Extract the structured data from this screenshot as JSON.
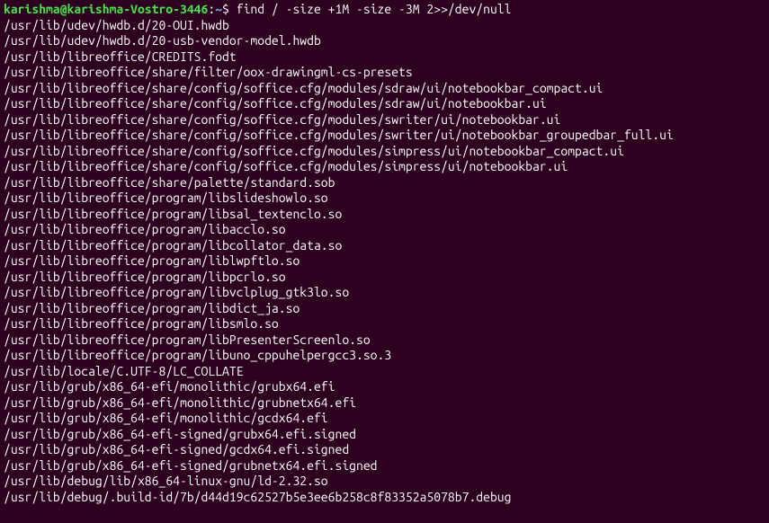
{
  "terminal": {
    "prompt": {
      "user_host": "karishma@karishma-Vostro-3446",
      "colon": ":",
      "path": "~",
      "dollar": "$"
    },
    "command": " find / -size +1M -size -3M 2>>/dev/null",
    "output": [
      "/usr/lib/udev/hwdb.d/20-OUI.hwdb",
      "/usr/lib/udev/hwdb.d/20-usb-vendor-model.hwdb",
      "/usr/lib/libreoffice/CREDITS.fodt",
      "/usr/lib/libreoffice/share/filter/oox-drawingml-cs-presets",
      "/usr/lib/libreoffice/share/config/soffice.cfg/modules/sdraw/ui/notebookbar_compact.ui",
      "/usr/lib/libreoffice/share/config/soffice.cfg/modules/sdraw/ui/notebookbar.ui",
      "/usr/lib/libreoffice/share/config/soffice.cfg/modules/swriter/ui/notebookbar.ui",
      "/usr/lib/libreoffice/share/config/soffice.cfg/modules/swriter/ui/notebookbar_groupedbar_full.ui",
      "/usr/lib/libreoffice/share/config/soffice.cfg/modules/simpress/ui/notebookbar_compact.ui",
      "/usr/lib/libreoffice/share/config/soffice.cfg/modules/simpress/ui/notebookbar.ui",
      "/usr/lib/libreoffice/share/palette/standard.sob",
      "/usr/lib/libreoffice/program/libslideshowlo.so",
      "/usr/lib/libreoffice/program/libsal_textenclo.so",
      "/usr/lib/libreoffice/program/libacclo.so",
      "/usr/lib/libreoffice/program/libcollator_data.so",
      "/usr/lib/libreoffice/program/liblwpftlo.so",
      "/usr/lib/libreoffice/program/libpcrlo.so",
      "/usr/lib/libreoffice/program/libvclplug_gtk3lo.so",
      "/usr/lib/libreoffice/program/libdict_ja.so",
      "/usr/lib/libreoffice/program/libsmlo.so",
      "/usr/lib/libreoffice/program/libPresenterScreenlo.so",
      "/usr/lib/libreoffice/program/libuno_cppuhelpergcc3.so.3",
      "/usr/lib/locale/C.UTF-8/LC_COLLATE",
      "/usr/lib/grub/x86_64-efi/monolithic/grubx64.efi",
      "/usr/lib/grub/x86_64-efi/monolithic/grubnetx64.efi",
      "/usr/lib/grub/x86_64-efi/monolithic/gcdx64.efi",
      "/usr/lib/grub/x86_64-efi-signed/grubx64.efi.signed",
      "/usr/lib/grub/x86_64-efi-signed/gcdx64.efi.signed",
      "/usr/lib/grub/x86_64-efi-signed/grubnetx64.efi.signed",
      "/usr/lib/debug/lib/x86_64-linux-gnu/ld-2.32.so",
      "/usr/lib/debug/.build-id/7b/d44d19c62527b5e3ee6b258c8f83352a5078b7.debug"
    ]
  }
}
